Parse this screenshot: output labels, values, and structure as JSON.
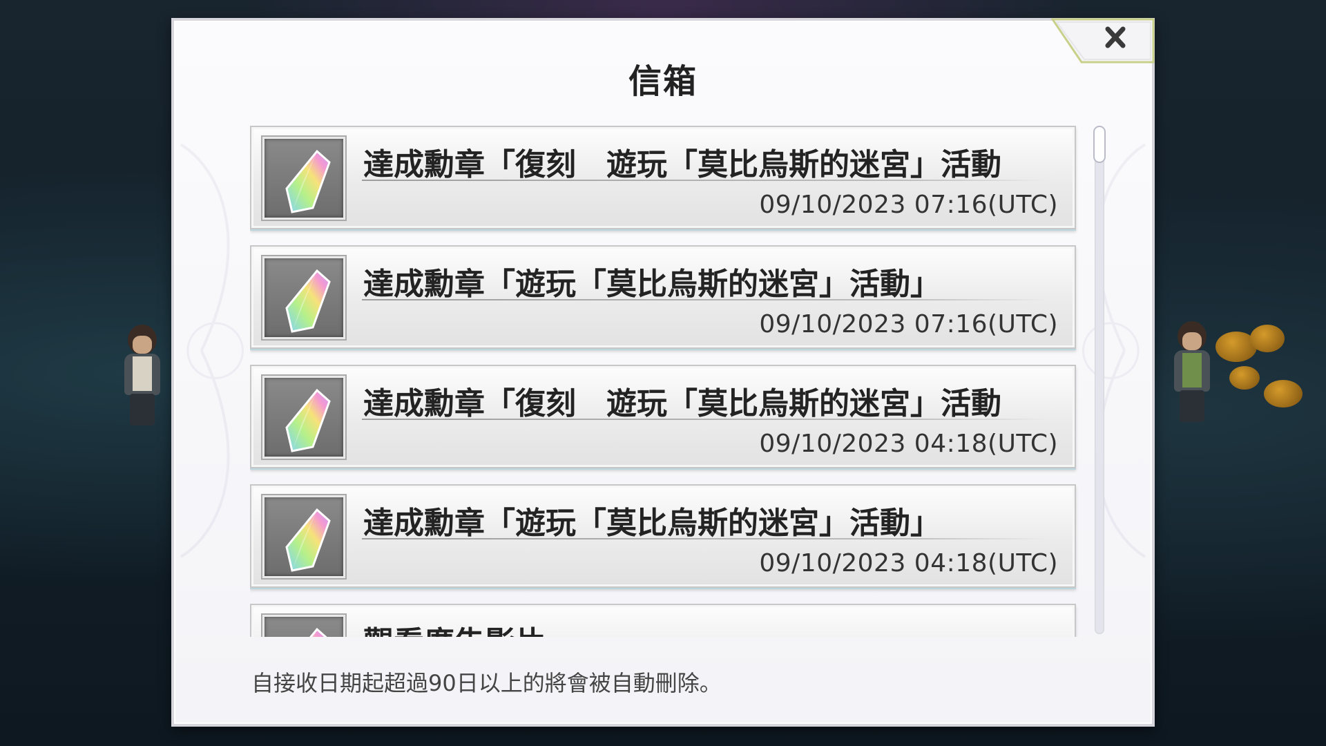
{
  "window": {
    "title": "信箱",
    "close_icon": "close-x-icon"
  },
  "mail_list": {
    "items": [
      {
        "icon": "rainbow-crystal-icon",
        "title": "達成勳章「復刻　遊玩「莫比烏斯的迷宮」活動",
        "date": "09/10/2023 07:16(UTC)"
      },
      {
        "icon": "rainbow-crystal-icon",
        "title": "達成勳章「遊玩「莫比烏斯的迷宮」活動」",
        "date": "09/10/2023 07:16(UTC)"
      },
      {
        "icon": "rainbow-crystal-icon",
        "title": "達成勳章「復刻　遊玩「莫比烏斯的迷宮」活動",
        "date": "09/10/2023 04:18(UTC)"
      },
      {
        "icon": "rainbow-crystal-icon",
        "title": "達成勳章「遊玩「莫比烏斯的迷宮」活動」",
        "date": "09/10/2023 04:18(UTC)"
      },
      {
        "icon": "rainbow-crystal-icon",
        "title": "觀看廣告影片",
        "date": ""
      }
    ],
    "scroll_position": 0
  },
  "footer": {
    "note": "自接收日期起超過90日以上的將會被自動刪除。"
  },
  "colors": {
    "modal_background": "#f6f6f9",
    "item_background": "#e9e9e9",
    "accent_frame": "#c8d2ee"
  }
}
